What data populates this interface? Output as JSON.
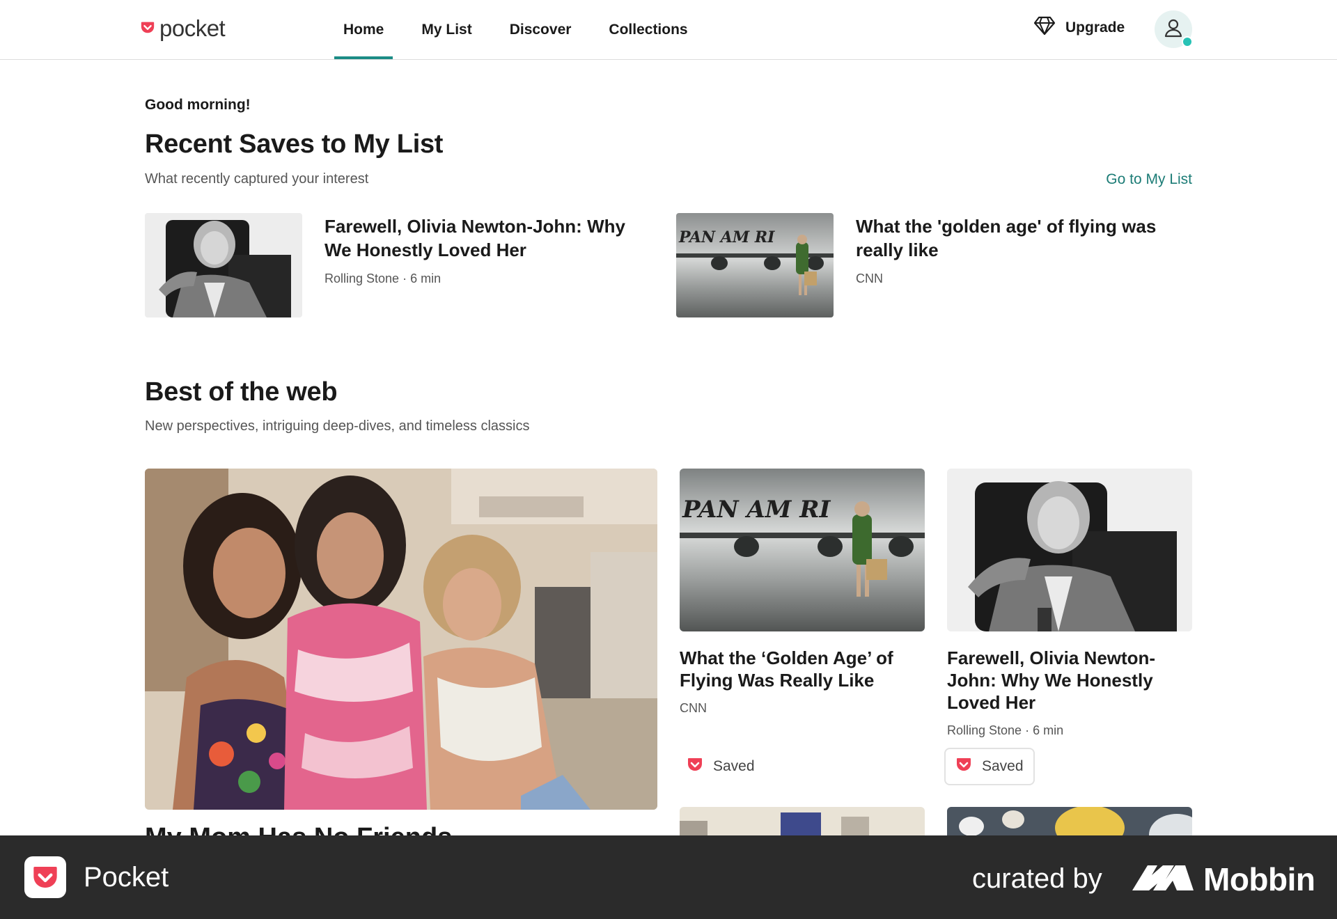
{
  "header": {
    "logo_text": "pocket",
    "nav": [
      {
        "label": "Home",
        "active": true
      },
      {
        "label": "My List",
        "active": false
      },
      {
        "label": "Discover",
        "active": false
      },
      {
        "label": "Collections",
        "active": false
      }
    ],
    "upgrade_label": "Upgrade"
  },
  "greeting": "Good morning!",
  "recent": {
    "title": "Recent Saves to My List",
    "subtitle": "What recently captured your interest",
    "go_link": "Go to My List",
    "items": [
      {
        "title": "Farewell, Olivia Newton-John: Why We Honestly Loved Her",
        "meta": "Rolling Stone · 6 min"
      },
      {
        "title": "What the 'golden age' of flying was really like",
        "meta": "CNN"
      }
    ]
  },
  "best": {
    "title": "Best of the web",
    "subtitle": "New perspectives, intriguing deep-dives, and timeless classics",
    "featured_title": "My Mom Has No Friends",
    "cards": [
      {
        "title": "What the ‘Golden Age’ of Flying Was Really Like",
        "meta": "CNN",
        "saved_label": "Saved"
      },
      {
        "title": "Farewell, Olivia Newton-John: Why We Honestly Loved Her",
        "meta": "Rolling Stone · 6 min",
        "saved_label": "Saved"
      }
    ]
  },
  "footer": {
    "app_name": "Pocket",
    "curated_by": "curated by",
    "brand": "Mobbin"
  },
  "colors": {
    "accent": "#1c8c86",
    "pocket_red": "#ef4056",
    "footer_bg": "#2b2b2b"
  },
  "icons": [
    "pocket-logo-icon",
    "diamond-icon",
    "user-icon",
    "pocket-saved-icon",
    "mobbin-logo-icon"
  ]
}
